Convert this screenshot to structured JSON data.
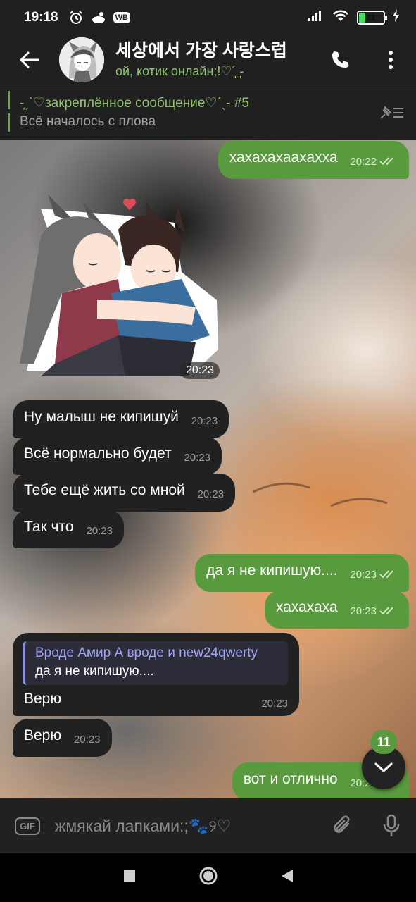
{
  "status_bar": {
    "time": "19:18",
    "battery": "31",
    "battery_level": 0.31,
    "icons": [
      "alarm-icon",
      "notification-icon",
      "wb-icon",
      "signal-icon",
      "wifi-icon",
      "battery-icon"
    ],
    "wb_label": "WB"
  },
  "header": {
    "title": "세상에서 가장 사랑스럽",
    "subtitle": "ой, котик онлайн;!♡´͈ ͈-",
    "icons": [
      "back-arrow-icon",
      "phone-icon",
      "more-vert-icon"
    ]
  },
  "pinned": {
    "title": "-͙ˏˋ♡закреплённое сообщение♡ˊˎ- #5",
    "body": "Всё началось с плова",
    "icon": "unpin-list-icon"
  },
  "messages": [
    {
      "dir": "out",
      "text": "хахахахаахахха",
      "time": "20:22",
      "read": true
    },
    {
      "dir": "in",
      "type": "sticker",
      "time": "20:23"
    },
    {
      "dir": "in",
      "text": "Ну малыш не кипишуй",
      "time": "20:23"
    },
    {
      "dir": "in",
      "text": "Всё нормально будет",
      "time": "20:23"
    },
    {
      "dir": "in",
      "text": "Тебе ещё жить со мной",
      "time": "20:23"
    },
    {
      "dir": "in",
      "text": "Так что",
      "time": "20:23"
    },
    {
      "dir": "out",
      "text": "да я не кипишую....",
      "time": "20:23",
      "read": true
    },
    {
      "dir": "out",
      "text": "хахахаха",
      "time": "20:23",
      "read": true
    },
    {
      "dir": "in",
      "reply_to": {
        "name": "Вроде Амир А вроде и new24qwerty",
        "text": "да я не кипишую...."
      },
      "text": "Верю",
      "time": "20:23"
    },
    {
      "dir": "in",
      "text": "Верю",
      "time": "20:23"
    },
    {
      "dir": "out",
      "text": "вот и отлично",
      "time": "20:24",
      "read": true
    }
  ],
  "unread_count": "11",
  "input": {
    "placeholder": "жмякай лапками:;🐾୨♡",
    "gif_label": "GIF",
    "icons": [
      "gif-icon",
      "attach-icon",
      "mic-icon"
    ]
  },
  "colors": {
    "bar_bg": "#202020",
    "incoming_bubble": "#212121",
    "outgoing_bubble": "#5a9a3e",
    "accent_green": "#8fc56a",
    "reply_accent": "#8b8ee8"
  }
}
